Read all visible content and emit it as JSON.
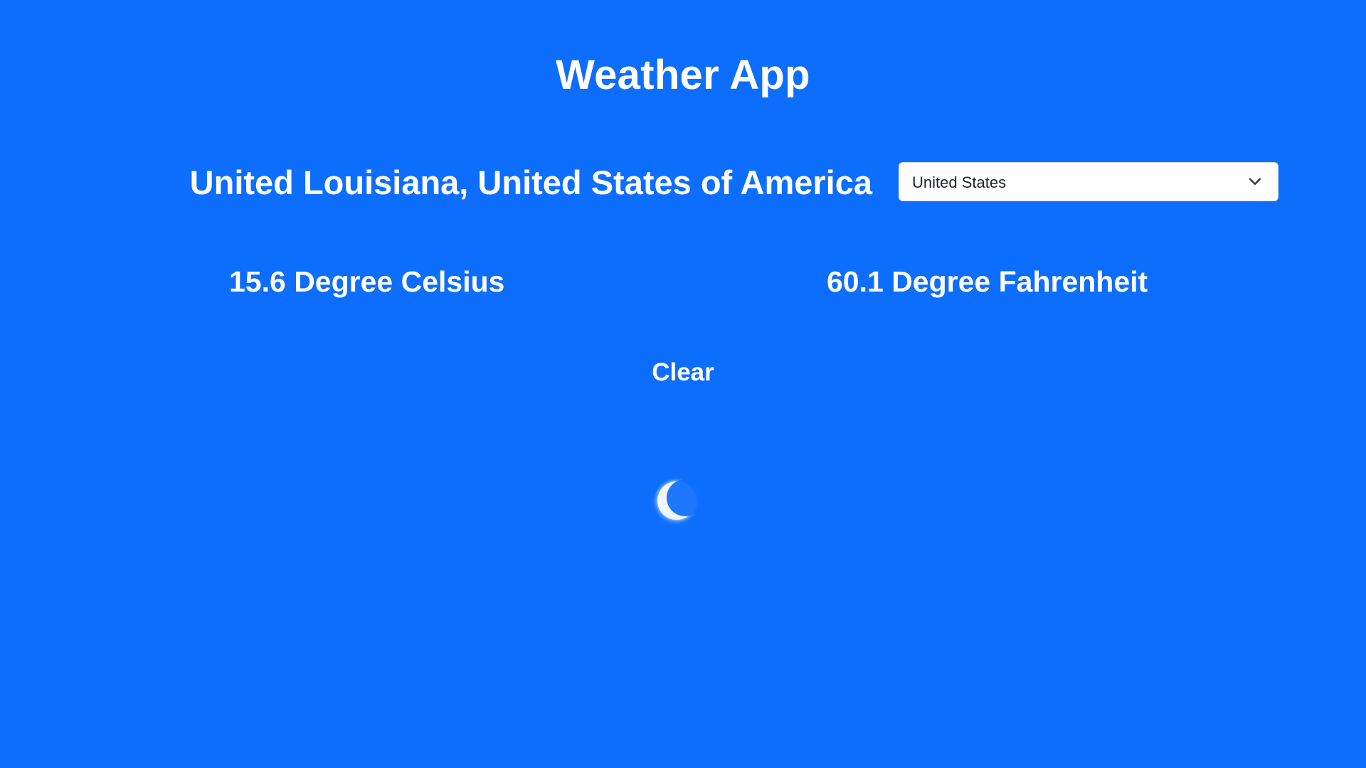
{
  "app": {
    "title": "Weather App"
  },
  "location": {
    "name": "United Louisiana, United States of America"
  },
  "country_select": {
    "selected": "United States",
    "icon": "chevron-down-icon"
  },
  "temperature": {
    "celsius": "15.6 Degree Celsius",
    "fahrenheit": "60.1 Degree Fahrenheit"
  },
  "condition": {
    "label": "Clear",
    "icon": "moon-icon"
  },
  "colors": {
    "background": "#0d6efd",
    "text": "#ffffff",
    "select_bg": "#ffffff",
    "select_text": "#212529"
  }
}
